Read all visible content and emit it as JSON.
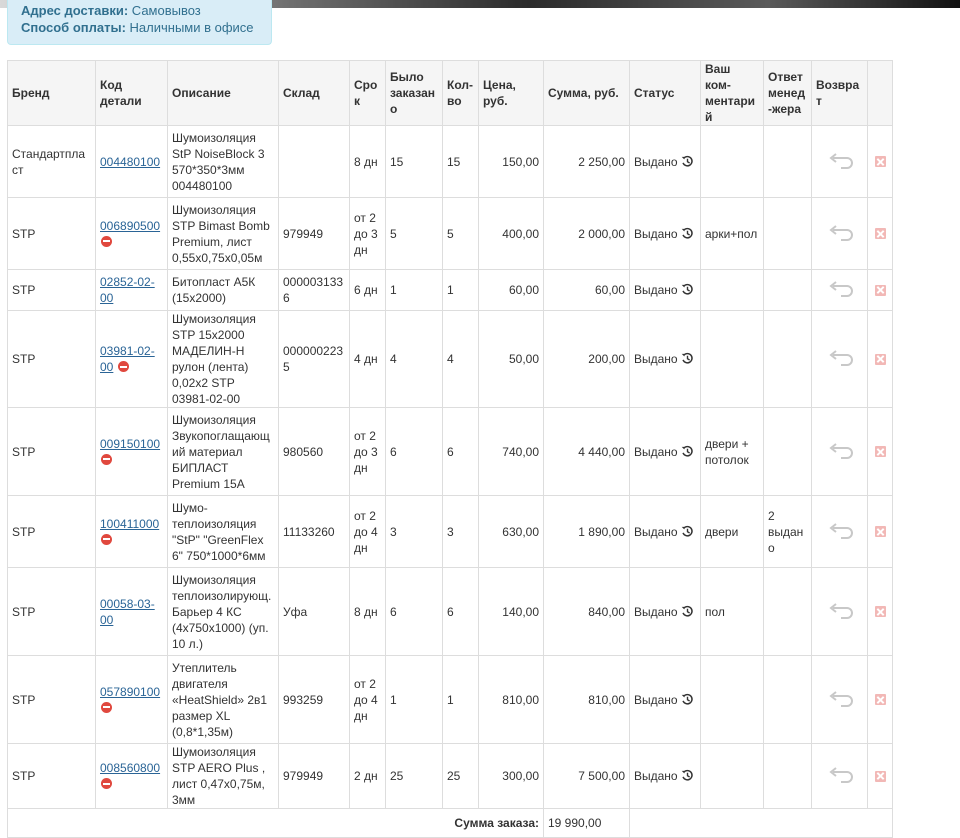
{
  "delivery": {
    "address_label": "Адрес доставки:",
    "address_value": "Самовывоз",
    "payment_label": "Способ оплаты:",
    "payment_value": "Наличными в офисе"
  },
  "columns": {
    "brand": "Бренд",
    "code": "Код детали",
    "desc": "Описание",
    "warehouse": "Склад",
    "term": "Срок",
    "ordered": "Было заказано",
    "qty": "Кол-во",
    "price": "Цена, руб.",
    "sum": "Сумма, руб.",
    "status": "Статус",
    "comment": "Ваш ком-ментарий",
    "manager": "Ответ менед-жера",
    "return": "Возврат"
  },
  "rows": [
    {
      "brand": "Стандартпласт",
      "code": "004480100",
      "code_disabled": false,
      "desc": "Шумоизоляция StP NoiseBlock 3 570*350*3мм 004480100",
      "warehouse": "",
      "term": "8 дн",
      "ordered": "15",
      "qty": "15",
      "price": "150,00",
      "sum": "2 250,00",
      "status": "Выдано",
      "comment": "",
      "manager": ""
    },
    {
      "brand": "STP",
      "code": "006890500",
      "code_disabled": true,
      "desc": "Шумоизоляция STP Bimast Bomb Premium, лист 0,55х0,75х0,05м",
      "warehouse": "979949",
      "term": "от 2 до 3 дн",
      "ordered": "5",
      "qty": "5",
      "price": "400,00",
      "sum": "2 000,00",
      "status": "Выдано",
      "comment": "арки+пол",
      "manager": ""
    },
    {
      "brand": "STP",
      "code": "02852-02-00",
      "code_disabled": false,
      "desc": "Битопласт А5К (15х2000)",
      "warehouse": "0000031336",
      "term": "6 дн",
      "ordered": "1",
      "qty": "1",
      "price": "60,00",
      "sum": "60,00",
      "status": "Выдано",
      "comment": "",
      "manager": ""
    },
    {
      "brand": "STP",
      "code": "03981-02-00",
      "code_disabled": true,
      "desc": "Шумоизоляция STP 15x2000 МАДЕЛИН-Н рулон (лента) 0,02х2 STP 03981-02-00",
      "warehouse": "0000002235",
      "term": "4 дн",
      "ordered": "4",
      "qty": "4",
      "price": "50,00",
      "sum": "200,00",
      "status": "Выдано",
      "comment": "",
      "manager": ""
    },
    {
      "brand": "STP",
      "code": "009150100",
      "code_disabled": true,
      "desc": "Шумоизоляция Звукопоглащающий материал БИПЛАСТ Premium 15А",
      "warehouse": "980560",
      "term": "от 2 до 3 дн",
      "ordered": "6",
      "qty": "6",
      "price": "740,00",
      "sum": "4 440,00",
      "status": "Выдано",
      "comment": "двери + потолок",
      "manager": ""
    },
    {
      "brand": "STP",
      "code": "100411000",
      "code_disabled": true,
      "desc": "Шумо-теплоизоляция \"StP\" \"GreenFlex 6\" 750*1000*6мм",
      "warehouse": "11133260",
      "term": "от 2 до 4 дн",
      "ordered": "3",
      "qty": "3",
      "price": "630,00",
      "sum": "1 890,00",
      "status": "Выдано",
      "comment": "двери",
      "manager": "2 выдано"
    },
    {
      "brand": "STP",
      "code": "00058-03-00",
      "code_disabled": false,
      "desc": "Шумоизоляция теплоизолирующ. Барьер 4 КС (4х750х1000) (уп. 10 л.)",
      "warehouse": "Уфа",
      "term": "8 дн",
      "ordered": "6",
      "qty": "6",
      "price": "140,00",
      "sum": "840,00",
      "status": "Выдано",
      "comment": "пол",
      "manager": ""
    },
    {
      "brand": "STP",
      "code": "057890100",
      "code_disabled": true,
      "desc": "Утеплитель двигателя «HeatShield» 2в1 размер XL (0,8*1,35м)",
      "warehouse": "993259",
      "term": "от 2 до 4 дн",
      "ordered": "1",
      "qty": "1",
      "price": "810,00",
      "sum": "810,00",
      "status": "Выдано",
      "comment": "",
      "manager": ""
    },
    {
      "brand": "STP",
      "code": "008560800",
      "code_disabled": true,
      "desc": "Шумоизоляция STP AERO Plus , лист 0,47х0,75м, 3мм",
      "warehouse": "979949",
      "term": "2 дн",
      "ordered": "25",
      "qty": "25",
      "price": "300,00",
      "sum": "7 500,00",
      "status": "Выдано",
      "comment": "",
      "manager": ""
    }
  ],
  "total": {
    "label": "Сумма заказа:",
    "value": "19 990,00"
  },
  "icons": {
    "history": "history-clock-icon",
    "return": "return-arrow-icon",
    "delete": "delete-x-icon",
    "disabled": "no-entry-icon"
  }
}
